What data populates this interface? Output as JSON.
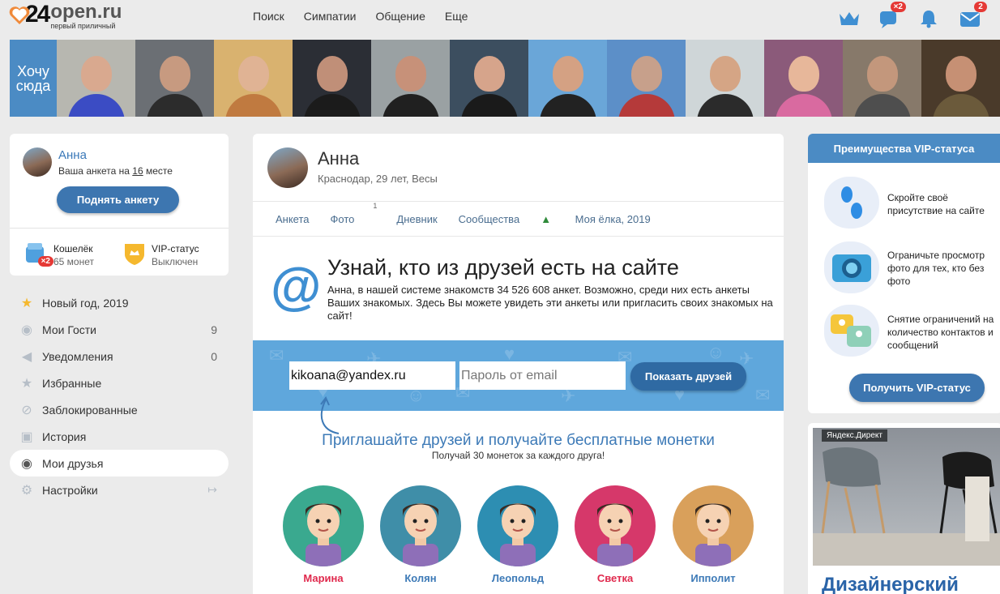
{
  "header": {
    "logo_number": "24",
    "logo_domain": "open.ru",
    "logo_slogan": "первый приличный",
    "nav": [
      "Поиск",
      "Симпатии",
      "Общение",
      "Еще"
    ],
    "icons": [
      {
        "name": "crown-icon",
        "badge": ""
      },
      {
        "name": "chat-icon",
        "badge": "×2"
      },
      {
        "name": "bell-icon",
        "badge": ""
      },
      {
        "name": "mail-icon",
        "badge": "2"
      }
    ]
  },
  "photo_strip": {
    "cta_line1": "Хочу",
    "cta_line2": "сюда",
    "photos": [
      {
        "bg": "#b7b7b0",
        "skin": "#d9a98f",
        "shirt": "#3b4cc4"
      },
      {
        "bg": "#6b6f74",
        "skin": "#c79a80",
        "shirt": "#2c2c2c"
      },
      {
        "bg": "#d9b26f",
        "skin": "#e0b394",
        "shirt": "#c07a40"
      },
      {
        "bg": "#2b2e35",
        "skin": "#c08f78",
        "shirt": "#1b1b1b"
      },
      {
        "bg": "#9aa1a3",
        "skin": "#c79179",
        "shirt": "#202020"
      },
      {
        "bg": "#3c4e5f",
        "skin": "#d6a48b",
        "shirt": "#1a1a1a"
      },
      {
        "bg": "#6aa6d8",
        "skin": "#d4a183",
        "shirt": "#222"
      },
      {
        "bg": "#5c8fc8",
        "skin": "#c7a08b",
        "shirt": "#b53a3a"
      },
      {
        "bg": "#cfd6d8",
        "skin": "#d5a585",
        "shirt": "#2b2b2b"
      },
      {
        "bg": "#8b5a7a",
        "skin": "#e7b79a",
        "shirt": "#d96aa0"
      },
      {
        "bg": "#87796a",
        "skin": "#c3977c",
        "shirt": "#4e4e4e"
      },
      {
        "bg": "#4a3a2a",
        "skin": "#c69074",
        "shirt": "#6b5a3b"
      }
    ]
  },
  "profile_card": {
    "name": "Анна",
    "rank_prefix": "Ваша анкета на ",
    "rank_number": "16",
    "rank_suffix": " месте",
    "raise_button": "Поднять анкету",
    "wallet_label": "Кошелёк",
    "wallet_value": "65 монет",
    "wallet_badge": "×2",
    "vip_label": "VIP-статус",
    "vip_value": "Выключен"
  },
  "menu": [
    {
      "label": "Новый год, 2019",
      "icon": "star-icon",
      "count": ""
    },
    {
      "label": "Мои Гости",
      "icon": "eye-icon",
      "count": "9"
    },
    {
      "label": "Уведомления",
      "icon": "megaphone-icon",
      "count": "0"
    },
    {
      "label": "Избранные",
      "icon": "star-outline-icon",
      "count": ""
    },
    {
      "label": "Заблокированные",
      "icon": "block-icon",
      "count": ""
    },
    {
      "label": "История",
      "icon": "history-icon",
      "count": ""
    },
    {
      "label": "Мои друзья",
      "icon": "friends-eye-icon",
      "count": ""
    },
    {
      "label": "Настройки",
      "icon": "gear-icon",
      "count": ""
    }
  ],
  "profile": {
    "name": "Анна",
    "info": "Краснодар, 29 лет, Весы",
    "tabs": [
      "Анкета",
      "Фото",
      "Дневник",
      "Сообщества",
      "Моя ёлка, 2019"
    ],
    "photo_count": "1"
  },
  "find_friends": {
    "title": "Узнай, кто из друзей есть на сайте",
    "description": "Анна, в нашей системе знакомств 34 526 608 анкет. Возможно, среди них есть анкеты Ваших знакомых. Здесь Вы можете увидеть эти анкеты или пригласить своих знакомых на сайт!",
    "email_value": "kikoana@yandex.ru",
    "password_placeholder": "Пароль от email",
    "show_button": "Показать друзей",
    "invite_title": "Приглашайте друзей и получайте бесплатные монетки",
    "invite_sub": "Получай 30 монеток за каждого друга!",
    "friends": [
      {
        "name": "Марина",
        "color": "#e0294d",
        "bg": "#3aa98f"
      },
      {
        "name": "Колян",
        "color": "#3d7ab7",
        "bg": "#3f8ea8"
      },
      {
        "name": "Леопольд",
        "color": "#3d7ab7",
        "bg": "#2d8eb2"
      },
      {
        "name": "Светка",
        "color": "#e0294d",
        "bg": "#d6386a"
      },
      {
        "name": "Ипполит",
        "color": "#3d7ab7",
        "bg": "#d9a05b"
      }
    ]
  },
  "vip": {
    "header": "Преимущества VIP-статуса",
    "benefits": [
      "Скройте своё присутствие на сайте",
      "Ограничьте просмотр фото для тех, кто без фото",
      "Снятие ограничений на количество контактов и сообщений"
    ],
    "button": "Получить VIP-статус"
  },
  "ad": {
    "tag": "Яндекс.Директ",
    "title": "Дизайнерский"
  }
}
